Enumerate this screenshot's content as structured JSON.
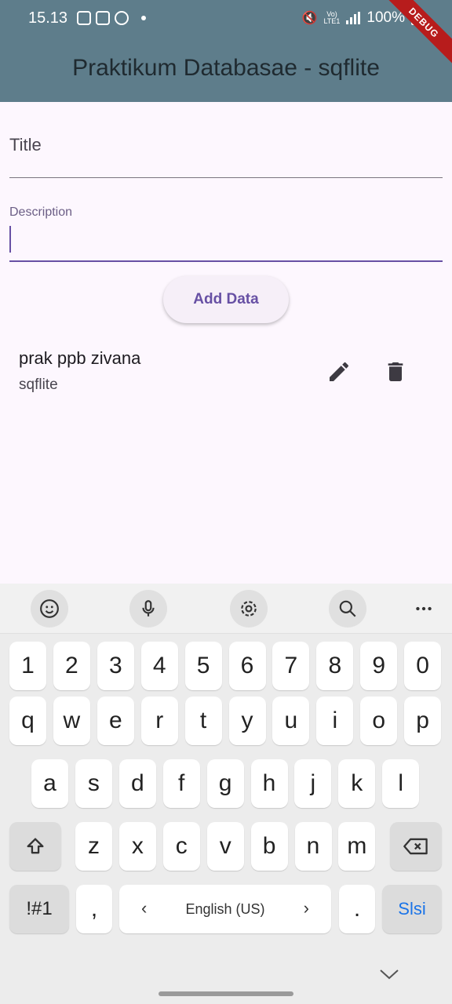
{
  "status_bar": {
    "time": "15.13",
    "battery": "100%",
    "network": "LTE1",
    "debug_banner": "DEBUG"
  },
  "app_bar": {
    "title": "Praktikum Databasae - sqflite"
  },
  "form": {
    "title_placeholder": "Title",
    "description_label": "Description",
    "add_button": "Add Data"
  },
  "items": [
    {
      "title": "prak ppb zivana",
      "subtitle": "sqflite"
    }
  ],
  "keyboard": {
    "toolbar": [
      "emoji-icon",
      "mic-icon",
      "settings-icon",
      "search-icon",
      "more-icon"
    ],
    "row_numbers": [
      "1",
      "2",
      "3",
      "4",
      "5",
      "6",
      "7",
      "8",
      "9",
      "0"
    ],
    "row1": [
      "q",
      "w",
      "e",
      "r",
      "t",
      "y",
      "u",
      "i",
      "o",
      "p"
    ],
    "row2": [
      "a",
      "s",
      "d",
      "f",
      "g",
      "h",
      "j",
      "k",
      "l"
    ],
    "row3": [
      "z",
      "x",
      "c",
      "v",
      "b",
      "n",
      "m"
    ],
    "symbols_key": "!#1",
    "comma_key": ",",
    "space_label": "English (US)",
    "period_key": ".",
    "action_key": "Slsi"
  },
  "colors": {
    "app_bar": "#5e7d8b",
    "background": "#fdf7fe",
    "accent": "#6750a4",
    "action_key": "#1a73e8"
  }
}
